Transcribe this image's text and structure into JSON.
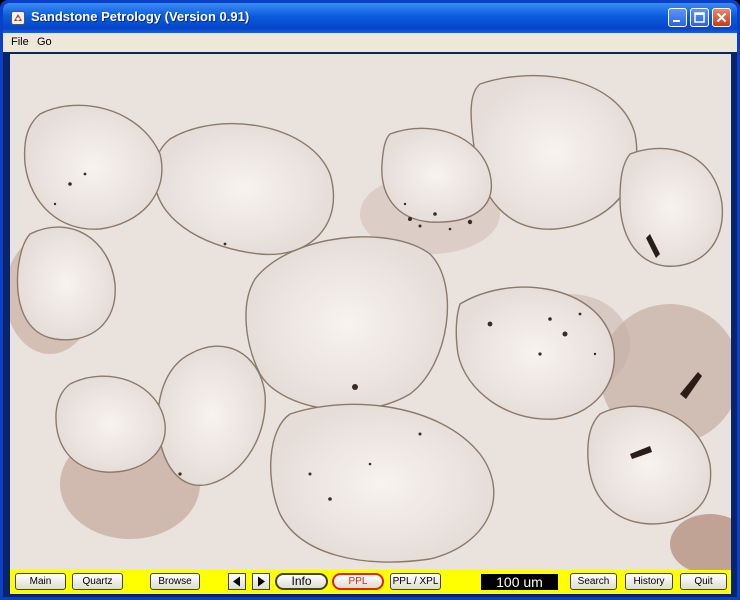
{
  "window": {
    "title": "Sandstone Petrology (Version 0.91)"
  },
  "menu": {
    "items": [
      "File",
      "Go"
    ]
  },
  "toolbar": {
    "main": "Main",
    "quartz": "Quartz",
    "browse": "Browse",
    "info": "Info",
    "ppl": "PPL",
    "ppl_xpl": "PPL / XPL",
    "scale": "100 um",
    "search": "Search",
    "history": "History",
    "quit": "Quit"
  },
  "colors": {
    "toolbar_bg": "#ffff00",
    "ppl_accent": "#e0201a",
    "titlebar": "#0a5bdc"
  },
  "icons": [
    "app-icon",
    "minimize-icon",
    "maximize-icon",
    "close-icon",
    "arrow-left-icon",
    "arrow-right-icon"
  ]
}
